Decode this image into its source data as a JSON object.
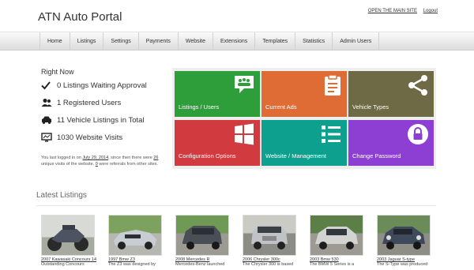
{
  "header": {
    "title": "ATN Auto Portal",
    "open_site": "OPEN THE MAIN SITE",
    "logout": "Logout"
  },
  "nav": [
    "Home",
    "Listings",
    "Settings",
    "Payments",
    "Website",
    "Extensions",
    "Templates",
    "Statistics",
    "Admin Users"
  ],
  "right_now": {
    "title": "Right Now",
    "stats": [
      "0 Listings Waiting Approval",
      "1 Registered Users",
      "11 Vehicle Listings in Total",
      "1030 Website Visits"
    ],
    "note": {
      "part1": "You last logged in on ",
      "date": "July 29, 2014",
      "part2": ", since then there were ",
      "unique": "26",
      "part3": " unique visits of the website. ",
      "referrals": "0",
      "part4": " were referrals from other sites."
    }
  },
  "tiles": [
    {
      "label": "Listings / Users",
      "color": "#2e9e3b",
      "icon": "users-chat-icon"
    },
    {
      "label": "Current Ads",
      "color": "#e06c35",
      "icon": "clipboard-icon"
    },
    {
      "label": "Vehicle Types",
      "color": "#6e6a45",
      "icon": "share-icon"
    },
    {
      "label": "Configuration Options",
      "color": "#d13a3f",
      "icon": "windows-icon"
    },
    {
      "label": "Website / Management",
      "color": "#0ea08f",
      "icon": "list-icon"
    },
    {
      "label": "Change Password",
      "color": "#8c3fd2",
      "icon": "lock-icon"
    }
  ],
  "latest": {
    "title": "Latest Listings",
    "items": [
      {
        "title": "2007 Kawasaki Concours 14",
        "desc": "Outstanding Concours"
      },
      {
        "title": "1997 Bmw Z3",
        "desc": "The Z3 was designed by"
      },
      {
        "title": "2008 Mercedes R",
        "desc": "Mercedes-Benz launched"
      },
      {
        "title": "2006 Chrysler 300c",
        "desc": "The Chrysler 300 is based"
      },
      {
        "title": "2003 Bmw 530",
        "desc": "The BMW 5 Series is a"
      },
      {
        "title": "2003 Jaguar S-type",
        "desc": "The S-Type was produced"
      }
    ]
  }
}
